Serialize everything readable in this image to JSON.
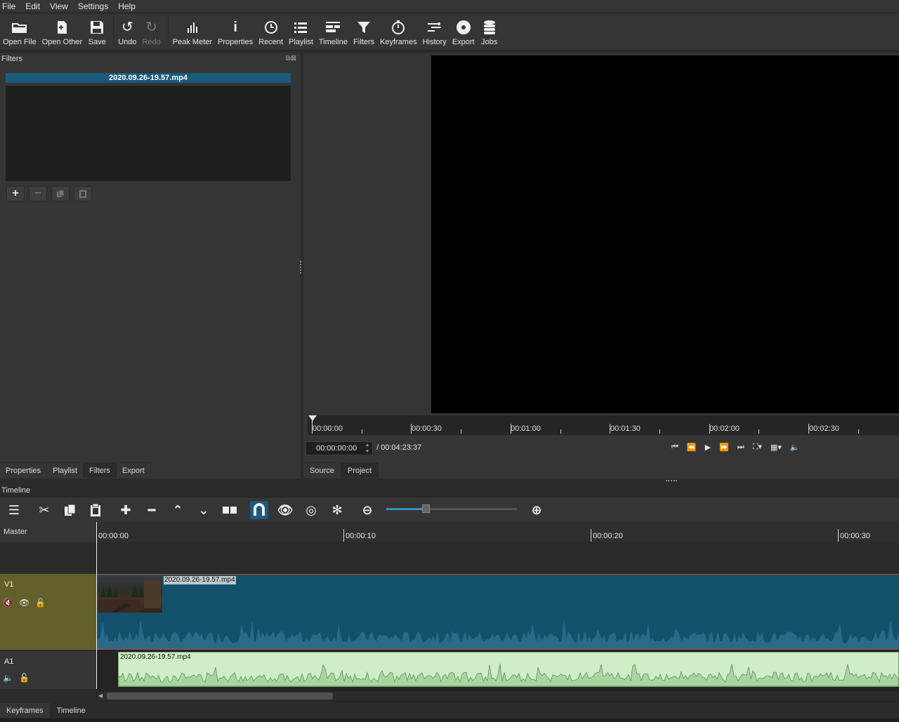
{
  "menu": [
    "File",
    "Edit",
    "View",
    "Settings",
    "Help"
  ],
  "toolbar": [
    {
      "label": "Open File",
      "icon": "folder-icon"
    },
    {
      "label": "Open Other",
      "icon": "open-other-icon"
    },
    {
      "label": "Save",
      "icon": "save-icon"
    },
    {
      "label": "Undo",
      "icon": "undo-icon"
    },
    {
      "label": "Redo",
      "icon": "redo-icon"
    },
    {
      "label": "Peak Meter",
      "icon": "peak-meter-icon"
    },
    {
      "label": "Properties",
      "icon": "info-icon"
    },
    {
      "label": "Recent",
      "icon": "clock-icon"
    },
    {
      "label": "Playlist",
      "icon": "list-icon"
    },
    {
      "label": "Timeline",
      "icon": "timeline-icon"
    },
    {
      "label": "Filters",
      "icon": "funnel-icon"
    },
    {
      "label": "Keyframes",
      "icon": "stopwatch-icon"
    },
    {
      "label": "History",
      "icon": "history-icon"
    },
    {
      "label": "Export",
      "icon": "disc-icon"
    },
    {
      "label": "Jobs",
      "icon": "database-icon"
    }
  ],
  "filters": {
    "title": "Filters",
    "clip_name": "2020.09.26-19.57.mp4"
  },
  "left_tabs": [
    "Properties",
    "Playlist",
    "Filters",
    "Export"
  ],
  "player": {
    "ruler_labels": [
      "00:00:00",
      "00:00:30",
      "00:01:00",
      "00:01:30",
      "00:02:00",
      "00:02:30"
    ],
    "timecode": "00:00:00:00",
    "duration": "/ 00:04:23:37"
  },
  "right_tabs": [
    "Source",
    "Project"
  ],
  "timeline": {
    "title": "Timeline",
    "ruler_labels": [
      "00:00:00",
      "00:00:10",
      "00:00:20",
      "00:00:30"
    ],
    "zoom_level": 0.3,
    "tracks": {
      "master": "Master",
      "v1": "V1",
      "a1": "A1"
    },
    "v1_clip": "2020.09.26-19.57.mp4",
    "a1_clip": "2020.09.26-19.57.mp4"
  },
  "bottom_tabs": [
    "Keyframes",
    "Timeline"
  ],
  "colors": {
    "accent": "#1e5a7e",
    "video_track_head": "#62602a",
    "video_clip": "#13506c",
    "audio_clip": "#cfeec8"
  }
}
